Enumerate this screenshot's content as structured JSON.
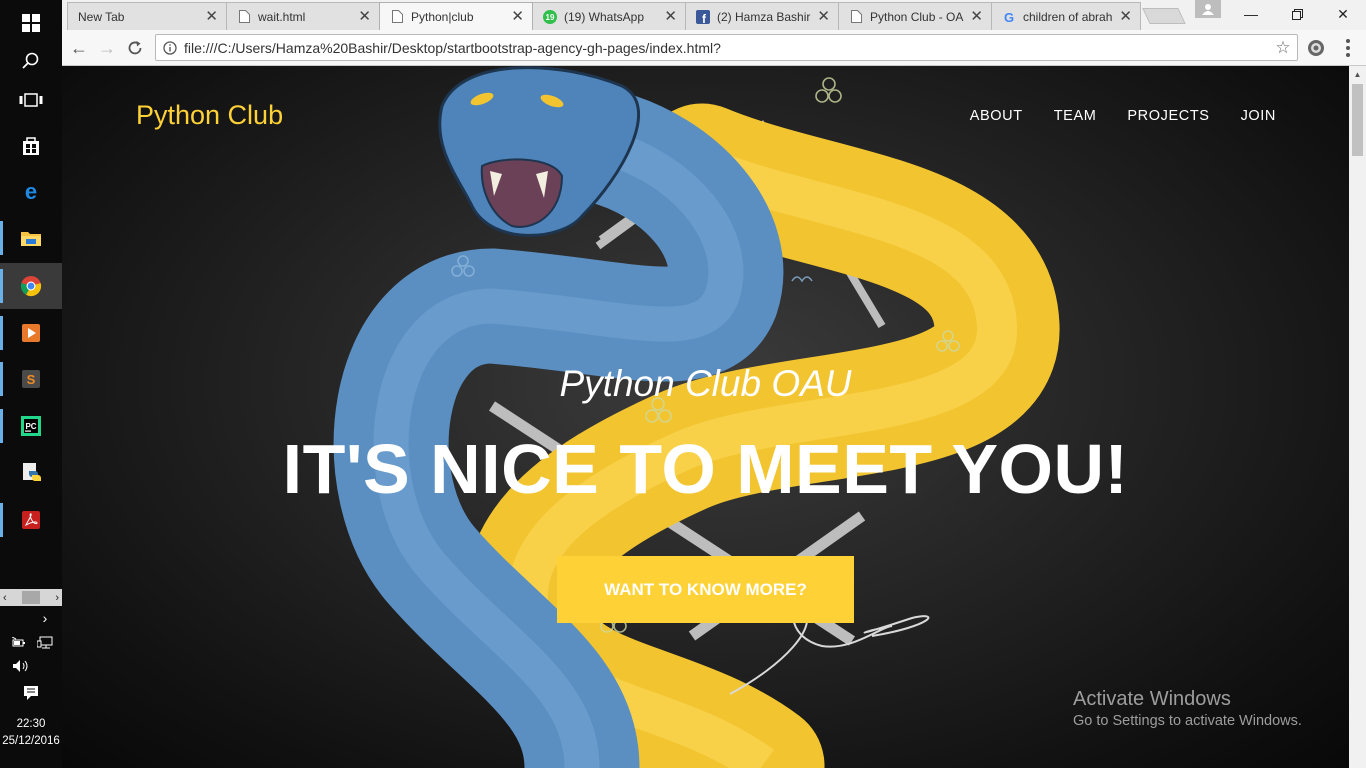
{
  "taskbar": {
    "apps": [
      {
        "name": "windows-start",
        "icon": "windows-logo-icon"
      },
      {
        "name": "search",
        "icon": "search-icon"
      },
      {
        "name": "task-view",
        "icon": "task-view-icon"
      },
      {
        "name": "store",
        "icon": "store-icon"
      },
      {
        "name": "edge",
        "icon": "edge-icon"
      },
      {
        "name": "file-explorer",
        "icon": "folder-icon"
      },
      {
        "name": "chrome",
        "icon": "chrome-icon"
      },
      {
        "name": "media-player",
        "icon": "media-player-icon"
      },
      {
        "name": "sublime-text",
        "icon": "sublime-icon"
      },
      {
        "name": "pycharm",
        "icon": "pycharm-icon"
      },
      {
        "name": "python",
        "icon": "python-icon"
      },
      {
        "name": "acrobat",
        "icon": "pdf-icon"
      }
    ],
    "clock": {
      "time": "22:30",
      "date": "25/12/2016"
    }
  },
  "browser": {
    "tabs": [
      {
        "label": "New Tab",
        "icon": "none",
        "active": false
      },
      {
        "label": "wait.html",
        "icon": "page-icon",
        "active": false
      },
      {
        "label": "Python|club",
        "icon": "page-icon",
        "active": true
      },
      {
        "label": "(19) WhatsApp",
        "icon": "whatsapp-icon",
        "badge": "19",
        "active": false
      },
      {
        "label": "(2) Hamza Bashir",
        "icon": "facebook-icon",
        "active": false
      },
      {
        "label": "Python Club - OA",
        "icon": "page-icon",
        "active": false
      },
      {
        "label": "children of abrah",
        "icon": "google-icon",
        "active": false
      }
    ],
    "url": "file:///C:/Users/Hamza%20Bashir/Desktop/startbootstrap-agency-gh-pages/index.html?",
    "colors": {
      "tabstrip": "#f1f1f1",
      "toolbar": "#f7f7f7"
    }
  },
  "site": {
    "brand": "Python Club",
    "nav": [
      "ABOUT",
      "TEAM",
      "PROJECTS",
      "JOIN"
    ],
    "hero": {
      "lead": "Python Club OAU",
      "heading": "IT'S NICE TO MEET YOU!",
      "cta": "WANT TO KNOW MORE?"
    },
    "colors": {
      "accent": "#fed136",
      "snake_blue": "#5b8fc2",
      "snake_yellow": "#f2c530"
    }
  },
  "watermark": {
    "title": "Activate Windows",
    "subtitle": "Go to Settings to activate Windows."
  }
}
